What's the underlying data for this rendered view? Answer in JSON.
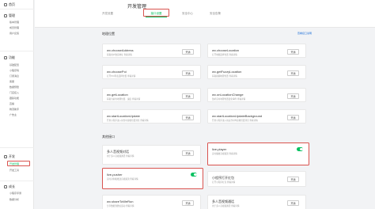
{
  "sidebar": {
    "home": "首页",
    "sections": [
      {
        "label": "管理",
        "items": [
          "版本管理",
          "成员管理",
          "用户反馈"
        ]
      },
      {
        "label": "功能",
        "items": [
          "基础配置",
          "小程序码",
          "订阅消息",
          "客服",
          "数据预警",
          "门店接入",
          "跟踪功能",
          "直播",
          "物流助手",
          "广告主"
        ]
      },
      {
        "label": "开发",
        "items": [
          "开发管理",
          "开发工具"
        ]
      },
      {
        "label": "成长",
        "items": [
          "小程序评测",
          "数据分析"
        ]
      }
    ],
    "active_item": "开发管理"
  },
  "header": {
    "title": "开发管理",
    "tabs": [
      "开发设置",
      "接口设置",
      "安全中心",
      "安全告警"
    ],
    "active_tab": "接口设置"
  },
  "location_section": {
    "title": "地理位置",
    "link": "查看接口说明"
  },
  "location_cards": [
    {
      "name": "wx.chooseAddress",
      "desc": "获取用户收货地址 查看详情",
      "button": "开通"
    },
    {
      "name": "wx.chooseLocation",
      "desc": "打开地图选择位置 查看详情",
      "button": "开通"
    },
    {
      "name": "wx.choosePoi",
      "desc": "打开POI列表选择位置 查看详情",
      "button": "开通"
    },
    {
      "name": "wx.getFuzzyLocation",
      "desc": "获取模糊地理位置 查看详情",
      "button": "开通"
    },
    {
      "name": "wx.getLocation",
      "desc": "获取当前的地理位置、速度 查看详情",
      "button": "开通"
    },
    {
      "name": "wx.onLocationChange",
      "desc": "监听实时地理位置变化事件 查看详情",
      "button": "开通"
    },
    {
      "name": "wx.startLocationUpdate",
      "desc": "开启小程序进入前台时接收位置消息 查看详情",
      "button": "开通"
    },
    {
      "name": "wx.startLocationUpdateBackground",
      "desc": "开启小程序进入前后台时均接收位置消息 查看详情",
      "button": "开通"
    }
  ],
  "other_section": {
    "title": "其他接口"
  },
  "other_cards": [
    {
      "name": "多人音视频对话",
      "desc": "用于多人音视频通话 查看详情",
      "button": "开通"
    },
    {
      "name": "live-player",
      "desc": "实时播放音视频流 查看详情",
      "toggle": true
    },
    {
      "name": "live-pusher",
      "desc": "实时录制和推送音视频流 查看详情",
      "toggle": true
    },
    {
      "name": "小程序打开红包",
      "desc": "打开小程序红包 查看详情",
      "button": "开通"
    },
    {
      "name": "wx.shareToWeRun",
      "desc": "分享数据到微信运动 查看详情",
      "button": "开通"
    },
    {
      "name": "多人音视频通话",
      "desc": "用于多人音视频通话 查看详情",
      "button": "开通"
    }
  ],
  "colors": {
    "accent": "#07c160",
    "highlight": "#d9534f",
    "link": "#1e6fd9"
  }
}
